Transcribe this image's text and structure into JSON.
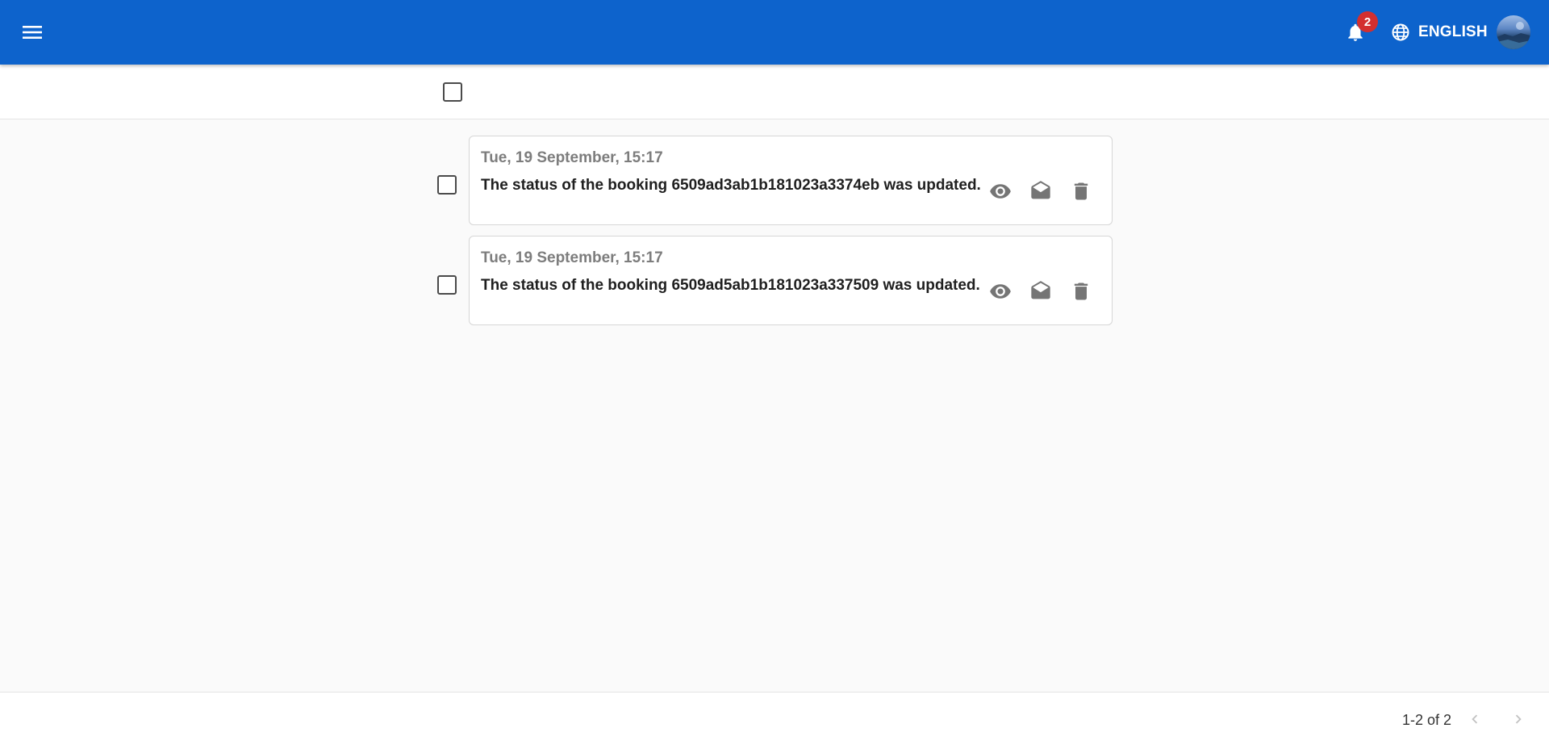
{
  "header": {
    "notifications_count": "2",
    "language_label": "ENGLISH",
    "accent_color": "#0d63cc",
    "badge_color": "#d32f2f"
  },
  "toolbar": {
    "select_all_checked": false
  },
  "notifications": [
    {
      "date": "Tue, 19 September, 15:17",
      "message": "The status of the booking 6509ad3ab1b181023a3374eb was updated.",
      "checked": false,
      "actions": [
        "eye-icon",
        "mark-read-icon",
        "delete-icon"
      ]
    },
    {
      "date": "Tue, 19 September, 15:17",
      "message": "The status of the booking 6509ad5ab1b181023a337509 was updated.",
      "checked": false,
      "actions": [
        "eye-icon",
        "mark-read-icon",
        "delete-icon"
      ]
    }
  ],
  "pager": {
    "range_label": "1-2 of 2"
  }
}
